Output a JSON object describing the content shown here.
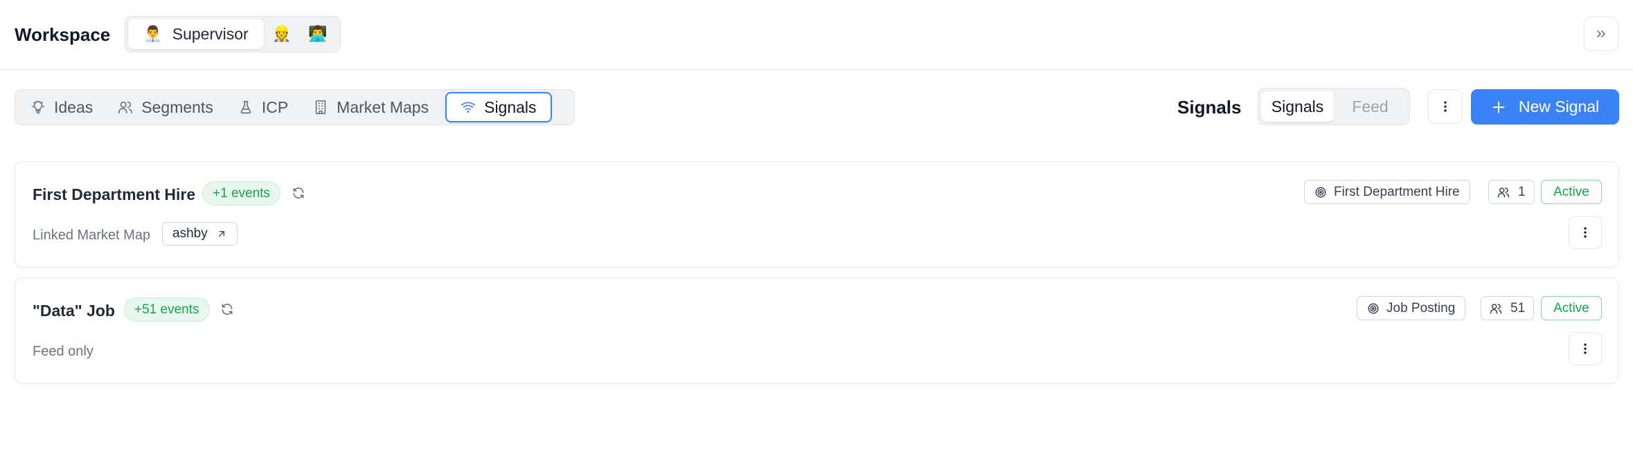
{
  "header": {
    "title": "Workspace",
    "roles": [
      {
        "emoji": "👨‍💼",
        "label": "Supervisor",
        "icon": "supervisor-emoji-icon"
      },
      {
        "emoji": "👷",
        "icon": "worker-emoji-icon"
      },
      {
        "emoji": "👨‍💻",
        "icon": "technologist-emoji-icon"
      }
    ],
    "collapse_icon": "chevrons-right-icon"
  },
  "nav": {
    "tabs": [
      {
        "label": "Ideas",
        "icon": "lightbulb-icon"
      },
      {
        "label": "Segments",
        "icon": "users-icon"
      },
      {
        "label": "ICP",
        "icon": "flask-icon"
      },
      {
        "label": "Market Maps",
        "icon": "building-icon"
      },
      {
        "label": "Signals",
        "icon": "wifi-icon",
        "active": true
      }
    ]
  },
  "toolbar": {
    "section_label": "Signals",
    "view_options": [
      "Signals",
      "Feed"
    ],
    "active_view": "Signals",
    "new_signal_label": "New Signal",
    "accent_color": "#3b82f6"
  },
  "signals": [
    {
      "title": "First Department Hire",
      "events_badge": "+1 events",
      "subtitle": "Linked Market Map",
      "linked_map": "ashby",
      "type": "First Department Hire",
      "count": "1",
      "status": "Active"
    },
    {
      "title": "\"Data\" Job",
      "events_badge": "+51 events",
      "subtitle": "Feed only",
      "type": "Job Posting",
      "count": "51",
      "status": "Active"
    }
  ],
  "colors": {
    "status_green": "#16a34a",
    "badge_bg": "#e8f7ee",
    "border": "#e5e7eb"
  }
}
